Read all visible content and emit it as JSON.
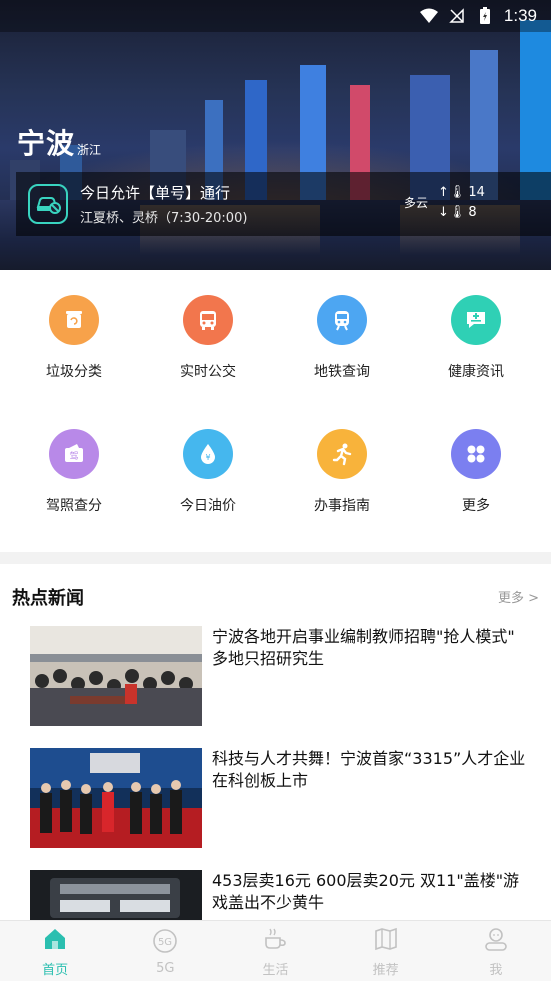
{
  "status_bar": {
    "time": "1:39"
  },
  "hero": {
    "city": "宁波",
    "province": "浙江",
    "traffic_line1": "今日允许【单号】通行",
    "traffic_line2": "江夏桥、灵桥（7:30-20:00)",
    "weather": "多云",
    "temp_high": "14",
    "temp_low": "8"
  },
  "services": [
    {
      "label": "垃圾分类",
      "color": "#f7a24a",
      "icon": "trash-icon"
    },
    {
      "label": "实时公交",
      "color": "#f2764d",
      "icon": "bus-icon"
    },
    {
      "label": "地铁查询",
      "color": "#4da6f2",
      "icon": "metro-icon"
    },
    {
      "label": "健康资讯",
      "color": "#2fd0b5",
      "icon": "health-chat-icon"
    },
    {
      "label": "驾照查分",
      "color": "#b889e8",
      "icon": "license-icon"
    },
    {
      "label": "今日油价",
      "color": "#45b7ee",
      "icon": "oil-drop-icon"
    },
    {
      "label": "办事指南",
      "color": "#f8b33b",
      "icon": "runner-icon"
    },
    {
      "label": "更多",
      "color": "#7b7ff0",
      "icon": "more-grid-icon"
    }
  ],
  "news_section": {
    "title": "热点新闻",
    "more": "更多 >",
    "items": [
      {
        "title": "宁波各地开启事业编制教师招聘\"抢人模式\" 多地只招研究生"
      },
      {
        "title": "科技与人才共舞！宁波首家“3315”人才企业在科创板上市"
      },
      {
        "title": "453层卖16元 600层卖20元 双11\"盖楼\"游戏盖出不少黄牛"
      }
    ]
  },
  "bottom_nav": [
    {
      "label": "首页",
      "icon": "home-icon",
      "active": true
    },
    {
      "label": "5G",
      "icon": "5g-icon",
      "active": false
    },
    {
      "label": "生活",
      "icon": "coffee-icon",
      "active": false
    },
    {
      "label": "推荐",
      "icon": "map-icon",
      "active": false
    },
    {
      "label": "我",
      "icon": "profile-icon",
      "active": false
    }
  ],
  "colors": {
    "accent": "#2bbfb0"
  }
}
